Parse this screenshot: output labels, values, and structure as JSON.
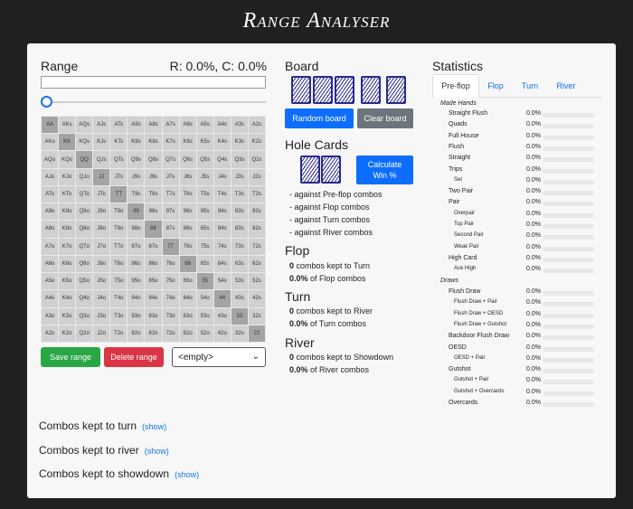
{
  "app": {
    "title": "Range Analyser"
  },
  "range": {
    "title": "Range",
    "stats": "R: 0.0%, C: 0.0%",
    "grid": [
      [
        "AA",
        "AKs",
        "AQs",
        "AJs",
        "ATs",
        "A9s",
        "A8s",
        "A7s",
        "A6s",
        "A5s",
        "A4s",
        "A3s",
        "A2s"
      ],
      [
        "AKo",
        "KK",
        "KQs",
        "KJs",
        "KTs",
        "K9s",
        "K8s",
        "K7s",
        "K6s",
        "K5s",
        "K4s",
        "K3s",
        "K2s"
      ],
      [
        "AQo",
        "KQo",
        "QQ",
        "QJs",
        "QTs",
        "Q9s",
        "Q8s",
        "Q7s",
        "Q6s",
        "Q5s",
        "Q4s",
        "Q3s",
        "Q2s"
      ],
      [
        "AJo",
        "KJo",
        "QJo",
        "JJ",
        "JTs",
        "J9s",
        "J8s",
        "J7s",
        "J6s",
        "J5s",
        "J4s",
        "J3s",
        "J2s"
      ],
      [
        "ATo",
        "KTo",
        "QTo",
        "JTo",
        "TT",
        "T9s",
        "T8s",
        "T7s",
        "T6s",
        "T5s",
        "T4s",
        "T3s",
        "T2s"
      ],
      [
        "A9o",
        "K9o",
        "Q9o",
        "J9o",
        "T9o",
        "99",
        "98s",
        "97s",
        "96s",
        "95s",
        "94s",
        "93s",
        "92s"
      ],
      [
        "A8o",
        "K8o",
        "Q8o",
        "J8o",
        "T8o",
        "98o",
        "88",
        "87s",
        "86s",
        "85s",
        "84s",
        "83s",
        "82s"
      ],
      [
        "A7o",
        "K7o",
        "Q7o",
        "J7o",
        "T7o",
        "97o",
        "87o",
        "77",
        "76s",
        "75s",
        "74s",
        "73s",
        "72s"
      ],
      [
        "A6o",
        "K6o",
        "Q6o",
        "J6o",
        "T6o",
        "96o",
        "86o",
        "76o",
        "66",
        "65s",
        "64s",
        "63s",
        "62s"
      ],
      [
        "A5o",
        "K5o",
        "Q5o",
        "J5o",
        "T5o",
        "95o",
        "85o",
        "75o",
        "65o",
        "55",
        "54s",
        "53s",
        "52s"
      ],
      [
        "A4o",
        "K4o",
        "Q4o",
        "J4o",
        "T4o",
        "94o",
        "84o",
        "74o",
        "64o",
        "54o",
        "44",
        "43s",
        "42s"
      ],
      [
        "A3o",
        "K3o",
        "Q3o",
        "J3o",
        "T3o",
        "93o",
        "83o",
        "73o",
        "63o",
        "53o",
        "43o",
        "33",
        "32s"
      ],
      [
        "A2o",
        "K2o",
        "Q2o",
        "J2o",
        "T2o",
        "92o",
        "82o",
        "72o",
        "62o",
        "52o",
        "42o",
        "32o",
        "22"
      ]
    ],
    "save_label": "Save range",
    "delete_label": "Delete range",
    "select_value": "<empty>"
  },
  "board": {
    "title": "Board",
    "random_label": "Random board",
    "clear_label": "Clear board"
  },
  "hole": {
    "title": "Hole Cards",
    "calc_line1": "Calculate",
    "calc_line2": "Win %",
    "against": [
      "- against Pre-flop combos",
      "- against Flop combos",
      "- against Turn combos",
      "- against River combos"
    ]
  },
  "flop": {
    "title": "Flop",
    "kept_count": "0",
    "kept_text": " combos kept to Turn",
    "pct": "0.0%",
    "pct_text": " of Flop combos"
  },
  "turn": {
    "title": "Turn",
    "kept_count": "0",
    "kept_text": " combos kept to River",
    "pct": "0.0%",
    "pct_text": " of Turn combos"
  },
  "river": {
    "title": "River",
    "kept_count": "0",
    "kept_text": " combos kept to Showdown",
    "pct": "0.0%",
    "pct_text": " of River combos"
  },
  "bottom": {
    "turn_label": "Combos kept to turn",
    "river_label": "Combos kept to river",
    "showdown_label": "Combos kept to showdown",
    "show": "(show)"
  },
  "statistics": {
    "title": "Statistics",
    "tabs": [
      "Pre-flop",
      "Flop",
      "Turn",
      "River"
    ],
    "made_heading": "Made Hands",
    "draws_heading": "Draws",
    "made": [
      {
        "label": "Straight Flush",
        "value": "0.0%",
        "level": 0
      },
      {
        "label": "Quads",
        "value": "0.0%",
        "level": 0
      },
      {
        "label": "Full House",
        "value": "0.0%",
        "level": 0
      },
      {
        "label": "Flush",
        "value": "0.0%",
        "level": 0
      },
      {
        "label": "Straight",
        "value": "0.0%",
        "level": 0
      },
      {
        "label": "Trips",
        "value": "0.0%",
        "level": 0
      },
      {
        "label": "Set",
        "value": "0.0%",
        "level": 1
      },
      {
        "label": "Two Pair",
        "value": "0.0%",
        "level": 0
      },
      {
        "label": "Pair",
        "value": "0.0%",
        "level": 0
      },
      {
        "label": "Overpair",
        "value": "0.0%",
        "level": 1
      },
      {
        "label": "Top Pair",
        "value": "0.0%",
        "level": 1
      },
      {
        "label": "Second Pair",
        "value": "0.0%",
        "level": 1
      },
      {
        "label": "Weak Pair",
        "value": "0.0%",
        "level": 1
      },
      {
        "label": "High Card",
        "value": "0.0%",
        "level": 0
      },
      {
        "label": "Ace High",
        "value": "0.0%",
        "level": 1
      }
    ],
    "draws": [
      {
        "label": "Flush Draw",
        "value": "0.0%",
        "level": 0
      },
      {
        "label": "Flush Draw + Pair",
        "value": "0.0%",
        "level": 1
      },
      {
        "label": "Flush Draw + OESD",
        "value": "0.0%",
        "level": 1
      },
      {
        "label": "Flush Draw + Gutshot",
        "value": "0.0%",
        "level": 1
      },
      {
        "label": "Backdoor Flush Draw",
        "value": "0.0%",
        "level": 0
      },
      {
        "label": "OESD",
        "value": "0.0%",
        "level": 0
      },
      {
        "label": "OESD + Pair",
        "value": "0.0%",
        "level": 1
      },
      {
        "label": "Gutshot",
        "value": "0.0%",
        "level": 0
      },
      {
        "label": "Gutshot + Pair",
        "value": "0.0%",
        "level": 1
      },
      {
        "label": "Gutshot + Overcards",
        "value": "0.0%",
        "level": 1
      },
      {
        "label": "Overcards",
        "value": "0.0%",
        "level": 0
      }
    ]
  }
}
